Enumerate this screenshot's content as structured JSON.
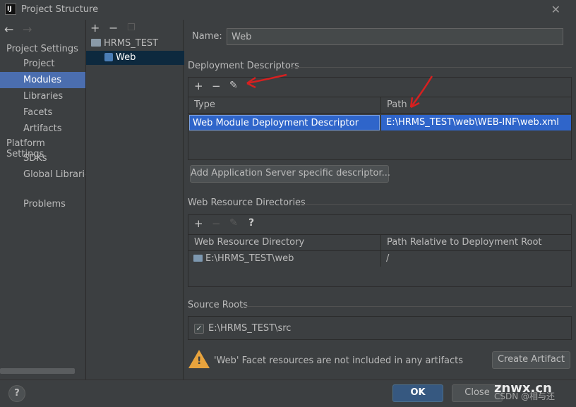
{
  "window": {
    "title": "Project Structure",
    "app_icon_text": "IJ"
  },
  "nav": {
    "back_icon": "arrow-left",
    "forward_icon": "arrow-right"
  },
  "sidebar": {
    "project_settings_header": "Project Settings",
    "project_items": [
      "Project",
      "Modules",
      "Libraries",
      "Facets",
      "Artifacts"
    ],
    "platform_settings_header": "Platform Settings",
    "platform_items": [
      "SDKs",
      "Global Libraries"
    ],
    "problems": "Problems",
    "selected": "Modules"
  },
  "tree": {
    "toolbar": {
      "add": "+",
      "remove": "−",
      "copy_icon": "copy"
    },
    "root": "HRMS_TEST",
    "child": "Web"
  },
  "content": {
    "name_label": "Name:",
    "name_value": "Web",
    "deployment": {
      "title": "Deployment Descriptors",
      "toolbar": {
        "add": "+",
        "remove": "−",
        "edit_icon": "pencil"
      },
      "columns": [
        "Type",
        "Path"
      ],
      "rows": [
        {
          "type": "Web Module Deployment Descriptor",
          "path": "E:\\HRMS_TEST\\web\\WEB-INF\\web.xml"
        }
      ],
      "add_button": "Add Application Server specific descriptor..."
    },
    "web_resources": {
      "title": "Web Resource Directories",
      "toolbar": {
        "add": "+",
        "remove": "−",
        "edit_icon": "pencil",
        "help": "?"
      },
      "columns": [
        "Web Resource Directory",
        "Path Relative to Deployment Root"
      ],
      "rows": [
        {
          "dir": "E:\\HRMS_TEST\\web",
          "path": "/"
        }
      ]
    },
    "source_roots": {
      "title": "Source Roots",
      "items": [
        {
          "label": "E:\\HRMS_TEST\\src",
          "checked": true
        }
      ]
    },
    "warning": {
      "text": "'Web' Facet resources are not included in any artifacts",
      "button": "Create Artifact"
    }
  },
  "footer": {
    "help": "?",
    "ok": "OK",
    "close": "Close"
  },
  "watermark": {
    "main": "znwx.cn",
    "sub": "CSDN @相与还"
  },
  "colors": {
    "background": "#3c3f41",
    "selection": "#4b6eaf",
    "table_selection": "#2f65ca",
    "tree_selection": "#0d293e",
    "warning": "#e8a33d",
    "annotation": "#d62020"
  }
}
